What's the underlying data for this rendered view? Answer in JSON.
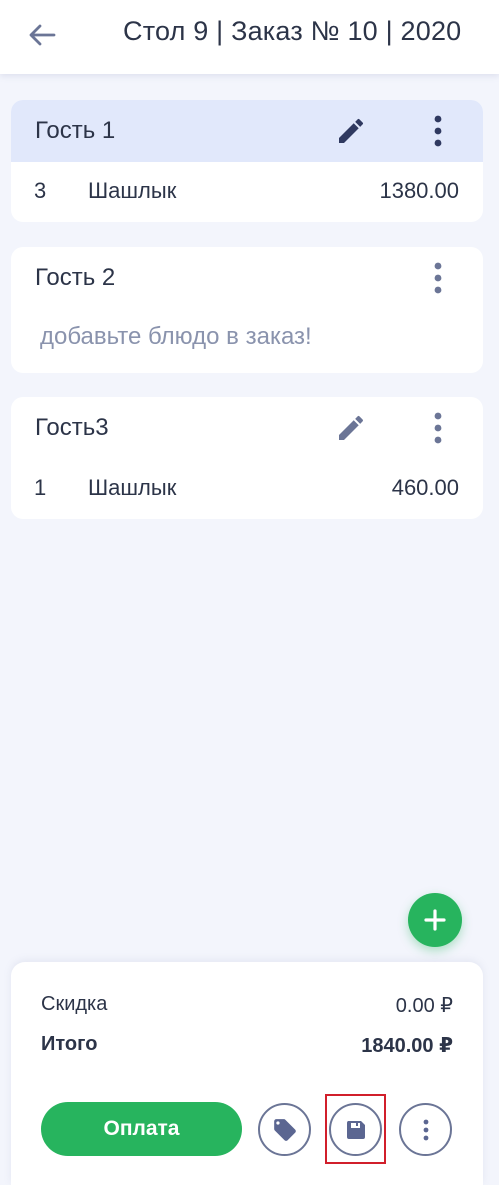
{
  "header": {
    "title": "Стол 9 | Заказ № 10 | 2020"
  },
  "guests": [
    {
      "name": "Гость 1",
      "active": true,
      "has_edit": true,
      "items": [
        {
          "qty": "3",
          "name": "Шашлык",
          "price": "1380.00"
        }
      ]
    },
    {
      "name": "Гость 2",
      "active": false,
      "has_edit": false,
      "empty_hint": "добавьте блюдо в заказ!"
    },
    {
      "name": "Гость3",
      "active": false,
      "has_edit": true,
      "items": [
        {
          "qty": "1",
          "name": "Шашлык",
          "price": "460.00"
        }
      ]
    }
  ],
  "summary": {
    "discount_label": "Скидка",
    "discount_value": "0.00 ₽",
    "total_label": "Итого",
    "total_value": "1840.00 ₽",
    "pay_label": "Оплата"
  },
  "colors": {
    "accent_green": "#27b45e",
    "active_card": "#e1e8fb",
    "icon": "#5b6691",
    "highlight": "#d11f2b"
  },
  "icons": {
    "back": "arrow-left-icon",
    "edit": "pencil-icon",
    "more": "more-vertical-icon",
    "add": "plus-icon",
    "discount": "tag-icon",
    "save": "floppy-disk-icon"
  }
}
